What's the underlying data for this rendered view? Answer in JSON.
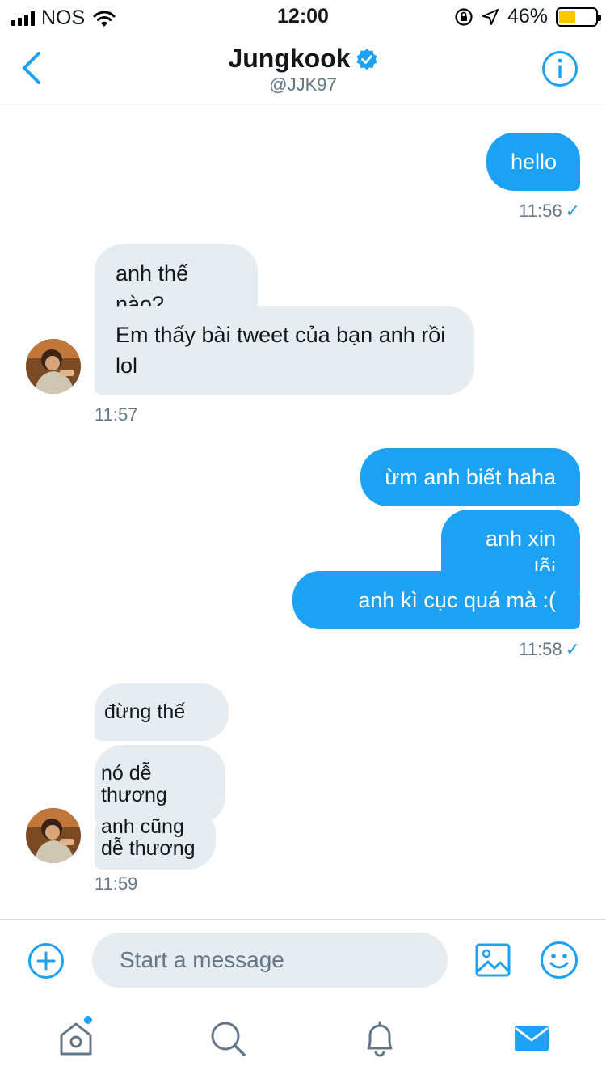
{
  "status_bar": {
    "carrier": "NOS",
    "time": "12:00",
    "battery": "46%",
    "battery_level": 0.46,
    "icons": [
      "signal-icon",
      "wifi-icon",
      "rotation-lock-icon",
      "location-icon",
      "battery-icon"
    ]
  },
  "header": {
    "name": "Jungkook",
    "handle": "@JJK97",
    "back_icon": "chevron-left-icon",
    "verified_icon": "verified-badge-icon",
    "info_icon": "info-icon"
  },
  "messages": [
    {
      "from": "me",
      "text": "hello"
    },
    {
      "time": "11:56",
      "read": true
    },
    {
      "from": "them",
      "text": "anh thế nào?"
    },
    {
      "from": "them",
      "text": "Em thấy bài tweet của bạn anh rồi lol"
    },
    {
      "time": "11:57"
    },
    {
      "from": "me",
      "text": "ừm anh biết haha"
    },
    {
      "from": "me",
      "text": "anh xin lỗi"
    },
    {
      "from": "me",
      "text": "anh kì cục quá mà :("
    },
    {
      "time": "11:58",
      "read": true
    },
    {
      "from": "them",
      "text": "đừng thế"
    },
    {
      "from": "them",
      "text": "nó dễ thương"
    },
    {
      "from": "them",
      "text": "anh cũng dễ thương"
    },
    {
      "time": "11:59"
    }
  ],
  "compose": {
    "placeholder": "Start a message",
    "icons": [
      "add-circle-icon",
      "image-icon",
      "emoji-icon"
    ]
  },
  "tabbar": {
    "items": [
      "home-icon",
      "search-icon",
      "notifications-icon",
      "messages-icon"
    ],
    "active": "messages-icon",
    "home_has_new": true
  },
  "colors": {
    "accent": "#1da1f2",
    "bubble_incoming": "#e6ecf0",
    "secondary_text": "#657786"
  }
}
